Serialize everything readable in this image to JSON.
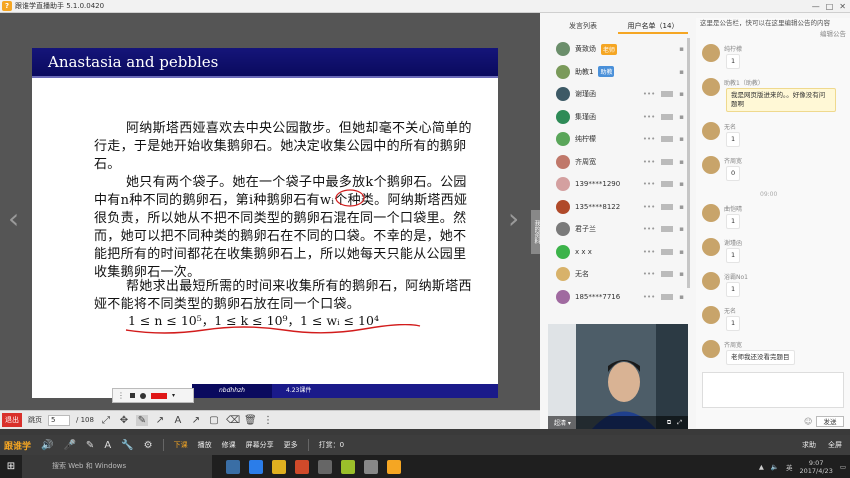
{
  "window": {
    "title": "跟谁学直播助手 5.1.0.0420",
    "logo": "?",
    "controls": [
      "—",
      "□",
      "✕"
    ]
  },
  "slide": {
    "title": "Anastasia and pebbles",
    "paragraphs": [
      [
        "阿纳斯塔西娅喜欢去中央公园散步。但她却毫不关心简单的",
        "行走，于是她开始收集鹅卵石。她决定收集公园中的所有的鹅卵",
        "石。"
      ],
      [
        "她只有两个袋子。她在一个袋子中最多放k个鹅卵石。公园",
        "中有n种不同的鹅卵石，第i种鹅卵石有wᵢ个种类。阿纳斯塔西娅",
        "很负责，所以她从不把不同类型的鹅卵石混在同一个口袋里。然",
        "而，她可以把不同种类的鹅卵石在不同的口袋。不幸的是，她不",
        "能把所有的时间都花在收集鹅卵石上，所以她每天只能从公园里",
        "收集鹅卵石一次。"
      ],
      [
        "帮她求出最短所需的时间来收集所有的鹅卵石，阿纳斯塔西",
        "娅不能将不同类型的鹅卵石放在同一个口袋。"
      ]
    ],
    "constraints": "1 ≤ n ≤ 10⁵，1 ≤ k ≤ 10⁹，1 ≤ wᵢ ≤ 10⁴",
    "footer_author": "nbdhhzh",
    "footer_date": "4.23课件"
  },
  "side_tab": "我的资料",
  "toolstrip": {
    "exit_label": "退出",
    "page_label": "跳页",
    "page_value": "5",
    "page_total": "/ 108"
  },
  "panel": {
    "tabs": [
      {
        "label": "发言列表",
        "active": false
      },
      {
        "label": "用户名单（14）",
        "active": true
      }
    ],
    "users": [
      {
        "name": "黄致炀",
        "badge": "老师",
        "badge_color": "#f5a623",
        "avatar": "#6b8e6b"
      },
      {
        "name": "助教1",
        "badge": "助教",
        "badge_color": "#4a90d9",
        "avatar": "#7a9a5a"
      },
      {
        "name": "谢瑾函",
        "badge": "",
        "avatar": "#3d5a66"
      },
      {
        "name": "集瑾函",
        "badge": "",
        "avatar": "#2e8b57"
      },
      {
        "name": "纯柠檬",
        "badge": "",
        "avatar": "#5aa65a"
      },
      {
        "name": "齐周宽",
        "badge": "",
        "avatar": "#c0786a"
      },
      {
        "name": "139****1290",
        "badge": "",
        "avatar": "#d4a0a0"
      },
      {
        "name": "135****8122",
        "badge": "",
        "avatar": "#b04a2a"
      },
      {
        "name": "君子兰",
        "badge": "",
        "avatar": "#7a7a7a"
      },
      {
        "name": "x x x",
        "badge": "",
        "avatar": "#3cb34a"
      },
      {
        "name": "无名",
        "badge": "",
        "avatar": "#d8b26a"
      },
      {
        "name": "185****7716",
        "badge": "",
        "avatar": "#a06aa0"
      }
    ],
    "user_more": "•••",
    "video_label": "超清 ▾"
  },
  "chat": {
    "notice": "这里是公告栏，快可以在这里编辑公告的内容",
    "notice_action": "编辑公告",
    "messages": [
      {
        "name": "纯柠檬",
        "text": "1",
        "yellow": false
      },
      {
        "name": "助教1（助教）",
        "text": "我是网页版进来的。。好像没有问题啊",
        "yellow": true
      },
      {
        "name": "无名",
        "text": "1",
        "yellow": false
      },
      {
        "name": "齐周宽",
        "text": "0",
        "yellow": false
      },
      {
        "name": "",
        "text": "",
        "yellow": false
      },
      {
        "name": "曲恺晴",
        "text": "1",
        "yellow": false
      },
      {
        "name": "谢瑾函",
        "text": "1",
        "yellow": false
      },
      {
        "name": "浴霸No1",
        "text": "1",
        "yellow": false
      },
      {
        "name": "无名",
        "text": "1",
        "yellow": false
      },
      {
        "name": "齐周宽",
        "text": "老师我还没看完题目",
        "yellow": false
      }
    ],
    "time_divider": "09:00",
    "send_label": "发送"
  },
  "appbar": {
    "brand": "跟谁学",
    "items": [
      "下课",
      "播放",
      "修课",
      "屏幕分享",
      "更多"
    ],
    "call": "打赏：0",
    "help": "求助",
    "fullscreen": "全屏"
  },
  "taskbar": {
    "search_placeholder": "搜索 Web 和 Windows",
    "time": "9:07",
    "date": "2017/4/23",
    "ime": "英"
  }
}
